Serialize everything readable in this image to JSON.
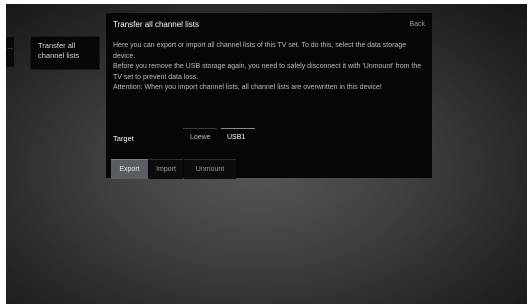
{
  "sidebar": {
    "stub_label": "...",
    "item_label": "Transfer all\nchannel lists"
  },
  "dialog": {
    "title": "Transfer all channel lists",
    "back_label": "Back",
    "paragraphs": [
      "Here you can export or import all channel lists of this TV set. To do this, select the data storage device.",
      "Before you remove the USB storage again, you need to safely disconnect it with 'Unmount' from the TV set to prevent data loss.",
      "Attention: When you import channel lists, all channel lists are overwritten in this device!"
    ],
    "target_label": "Target",
    "target_options": [
      "Loewe",
      "USB1"
    ],
    "target_selected": "USB1"
  },
  "buttons": {
    "export": "Export",
    "import": "Import",
    "unmount": "Unmount",
    "active": "Export"
  }
}
